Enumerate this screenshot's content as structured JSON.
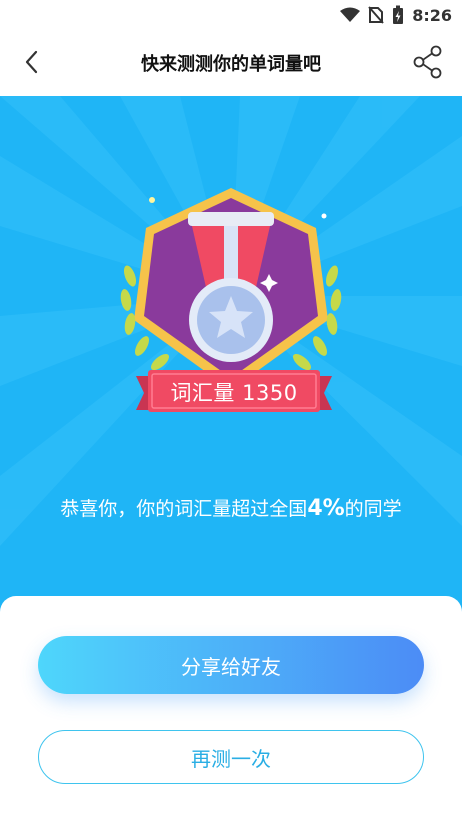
{
  "status": {
    "time": "8:26",
    "icons": [
      "wifi-icon",
      "no-sim-icon",
      "battery-charging-icon"
    ]
  },
  "nav": {
    "title": "快来测测你的单词量吧",
    "back_icon": "chevron-left-icon",
    "share_icon": "share-icon"
  },
  "result": {
    "score_label": "词汇量 1350",
    "congrats_prefix": "恭喜你，你的词汇量超过全国",
    "percent": "4%",
    "congrats_suffix": "的同学"
  },
  "actions": {
    "share_label": "分享给好友",
    "retest_label": "再测一次"
  },
  "colors": {
    "hero_bg": "#1fb5f6",
    "badge_purple": "#8a3a9c",
    "ribbon_red": "#f04a63",
    "gold": "#f5c542"
  }
}
